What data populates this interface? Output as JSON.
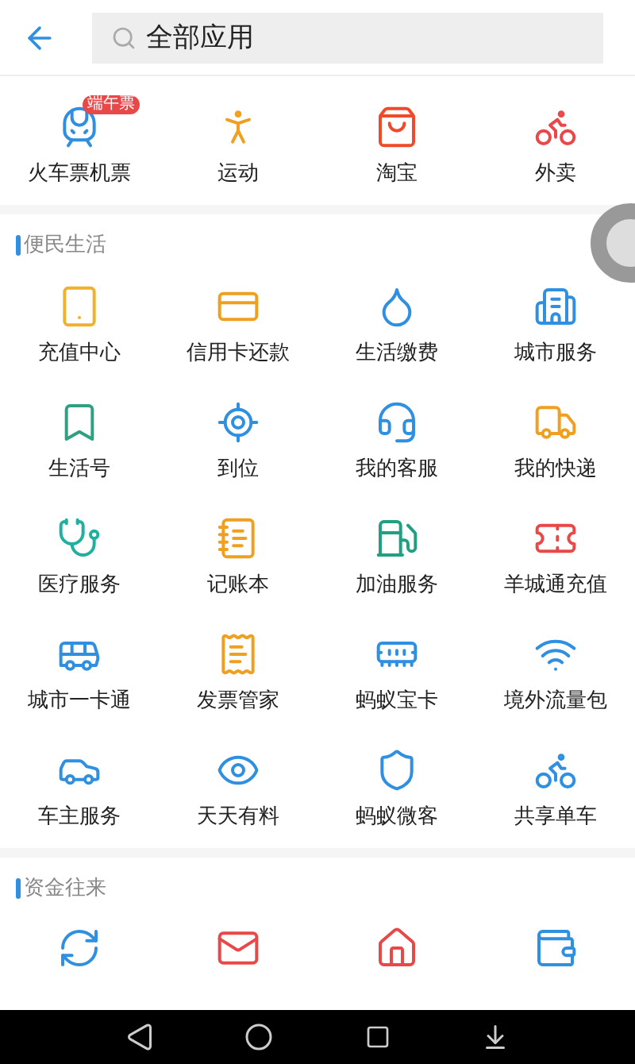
{
  "header": {
    "search": {
      "placeholder": "全部应用"
    }
  },
  "top_apps": [
    {
      "label": "火车票机票",
      "badge": "端午票"
    },
    {
      "label": "运动"
    },
    {
      "label": "淘宝"
    },
    {
      "label": "外卖"
    }
  ],
  "sections": [
    {
      "title": "便民生活",
      "apps": [
        {
          "label": "充值中心"
        },
        {
          "label": "信用卡还款"
        },
        {
          "label": "生活缴费"
        },
        {
          "label": "城市服务"
        },
        {
          "label": "生活号"
        },
        {
          "label": "到位"
        },
        {
          "label": "我的客服"
        },
        {
          "label": "我的快递"
        },
        {
          "label": "医疗服务"
        },
        {
          "label": "记账本"
        },
        {
          "label": "加油服务"
        },
        {
          "label": "羊城通充值"
        },
        {
          "label": "城市一卡通"
        },
        {
          "label": "发票管家"
        },
        {
          "label": "蚂蚁宝卡"
        },
        {
          "label": "境外流量包"
        },
        {
          "label": "车主服务"
        },
        {
          "label": "天天有料"
        },
        {
          "label": "蚂蚁微客"
        },
        {
          "label": "共享单车"
        }
      ]
    },
    {
      "title": "资金往来",
      "apps": [
        {
          "kind": "cut_off"
        },
        {
          "kind": "cut_off"
        },
        {
          "kind": "cut_off"
        },
        {
          "kind": "cut_off"
        }
      ]
    }
  ]
}
